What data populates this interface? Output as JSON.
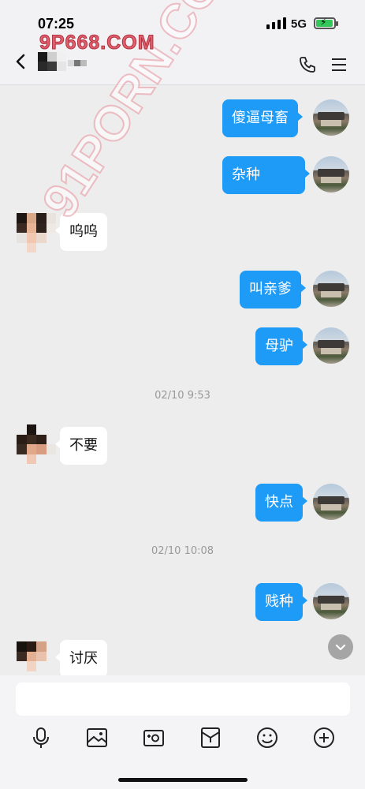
{
  "status_bar": {
    "time": "07:25",
    "network": "5G",
    "battery_level": 0.75,
    "battery_color": "#34c759"
  },
  "header": {
    "watermark": "9P668.COM",
    "icons": [
      "back-icon",
      "phone-icon",
      "menu-icon"
    ]
  },
  "watermark_diagonal": "91PORN.COM",
  "messages": [
    {
      "side": "out",
      "text": "傻逼母畜"
    },
    {
      "side": "out",
      "text": "杂种"
    },
    {
      "side": "in",
      "text": "呜呜"
    },
    {
      "side": "out",
      "text": "叫亲爹"
    },
    {
      "side": "out",
      "text": "母驴"
    },
    {
      "side": "time",
      "text": "02/10 9:53"
    },
    {
      "side": "in",
      "text": "不要"
    },
    {
      "side": "out",
      "text": "快点"
    },
    {
      "side": "time",
      "text": "02/10 10:08"
    },
    {
      "side": "out",
      "text": "贱种"
    },
    {
      "side": "in",
      "text": "讨厌"
    }
  ],
  "input": {
    "value": "",
    "placeholder": ""
  },
  "toolbar": {
    "icons": [
      "microphone-icon",
      "image-icon",
      "camera-icon",
      "wallet-icon",
      "emoji-icon",
      "plus-icon"
    ]
  },
  "colors": {
    "outgoing_bubble": "#1e9af7",
    "incoming_bubble": "#ffffff",
    "background": "#ededed"
  }
}
